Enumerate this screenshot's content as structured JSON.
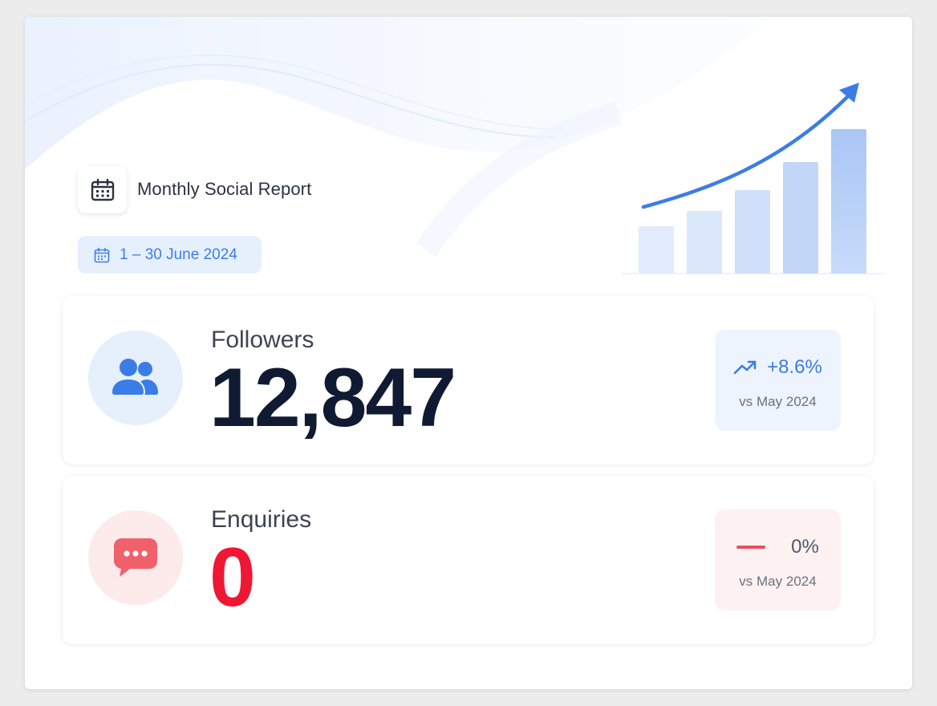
{
  "header": {
    "title": "Monthly Social Report",
    "date_range": "1 – 30 June 2024"
  },
  "metrics": [
    {
      "label": "Followers",
      "value": "12,847",
      "change": "+8.6%",
      "trend": "up",
      "comparison": "vs May 2024",
      "icon": "users-icon"
    },
    {
      "label": "Enquiries",
      "value": "0",
      "change": "0%",
      "trend": "flat",
      "comparison": "vs May 2024",
      "icon": "chat-bubble-icon"
    }
  ],
  "colors": {
    "accent_blue": "#3b7de6",
    "accent_red": "#ef1734",
    "text_dark": "#101a33"
  }
}
